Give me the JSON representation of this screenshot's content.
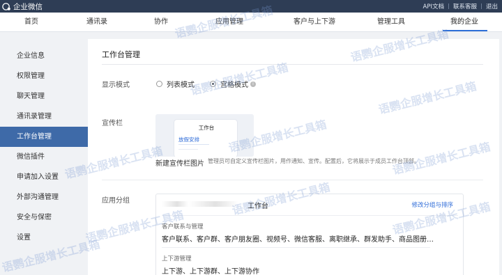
{
  "topbar": {
    "app_name": "企业微信",
    "links": [
      "API文档",
      "联系客服",
      "退出"
    ]
  },
  "nav": {
    "items": [
      "首页",
      "通讯录",
      "协作",
      "应用管理",
      "客户与上下游",
      "管理工具",
      "我的企业"
    ],
    "active": "我的企业"
  },
  "sidebar": {
    "items": [
      "企业信息",
      "权限管理",
      "聊天管理",
      "通讯录管理",
      "工作台管理",
      "微信插件",
      "申请加入设置",
      "外部沟通管理",
      "安全与保密",
      "设置"
    ],
    "active": "工作台管理"
  },
  "main": {
    "title": "工作台管理",
    "display_mode": {
      "label": "显示模式",
      "options": [
        "列表模式",
        "宫格模式"
      ],
      "selected": "宫格模式"
    },
    "banner": {
      "label": "宣传栏",
      "preview_title": "工作台",
      "preview_item": "放假安排",
      "new_link": "新建宣传栏图片",
      "hint": "管理员可自定义宣传栏图片，用作通知、宣传。配置后，它将展示于成员工作台顶部。"
    },
    "app_group": {
      "label": "应用分组",
      "workspace_name": "工作台",
      "action": "修改分组与排序",
      "categories": [
        {
          "title": "客户联系与管理",
          "apps": "客户联系、客户群、客户朋友圈、视频号、微信客服、离职继承、群发助手、商品图册、对..."
        },
        {
          "title": "上下游管理",
          "apps": "上下游、上下游群、上下游协作"
        }
      ]
    }
  },
  "watermark": {
    "text": "语鹦企服增长工具箱"
  },
  "colors": {
    "topbar": "#2e3d55",
    "sidebar_active": "#3e6aa8",
    "link": "#2f6cd8",
    "watermark": "#7896d2"
  }
}
